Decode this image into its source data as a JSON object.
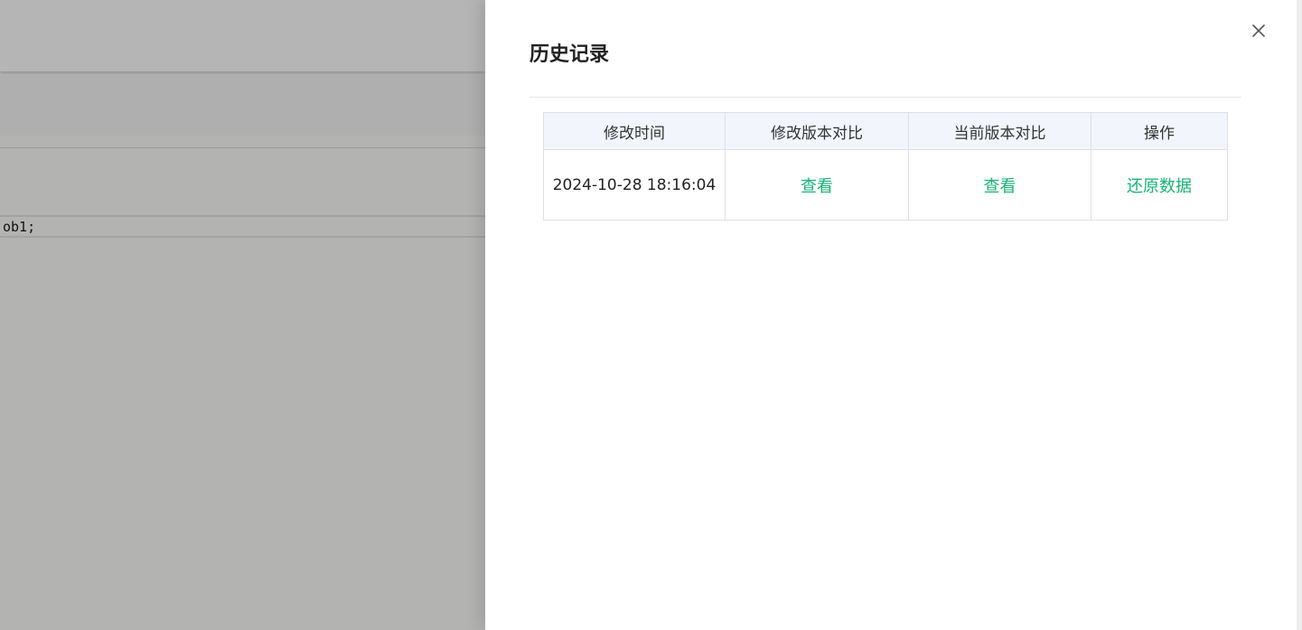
{
  "background": {
    "code_snippet": "ob1;"
  },
  "drawer": {
    "title": "历史记录",
    "table": {
      "headers": [
        "修改时间",
        "修改版本对比",
        "当前版本对比",
        "操作"
      ],
      "rows": [
        {
          "time": "2024-10-28 18:16:04",
          "modified_compare": "查看",
          "current_compare": "查看",
          "action": "还原数据"
        }
      ]
    }
  },
  "colors": {
    "link": "#19b277",
    "header_bg": "#f2f6fc",
    "overlay": "#b3b3b2"
  },
  "icons": {
    "close": "close-icon"
  }
}
